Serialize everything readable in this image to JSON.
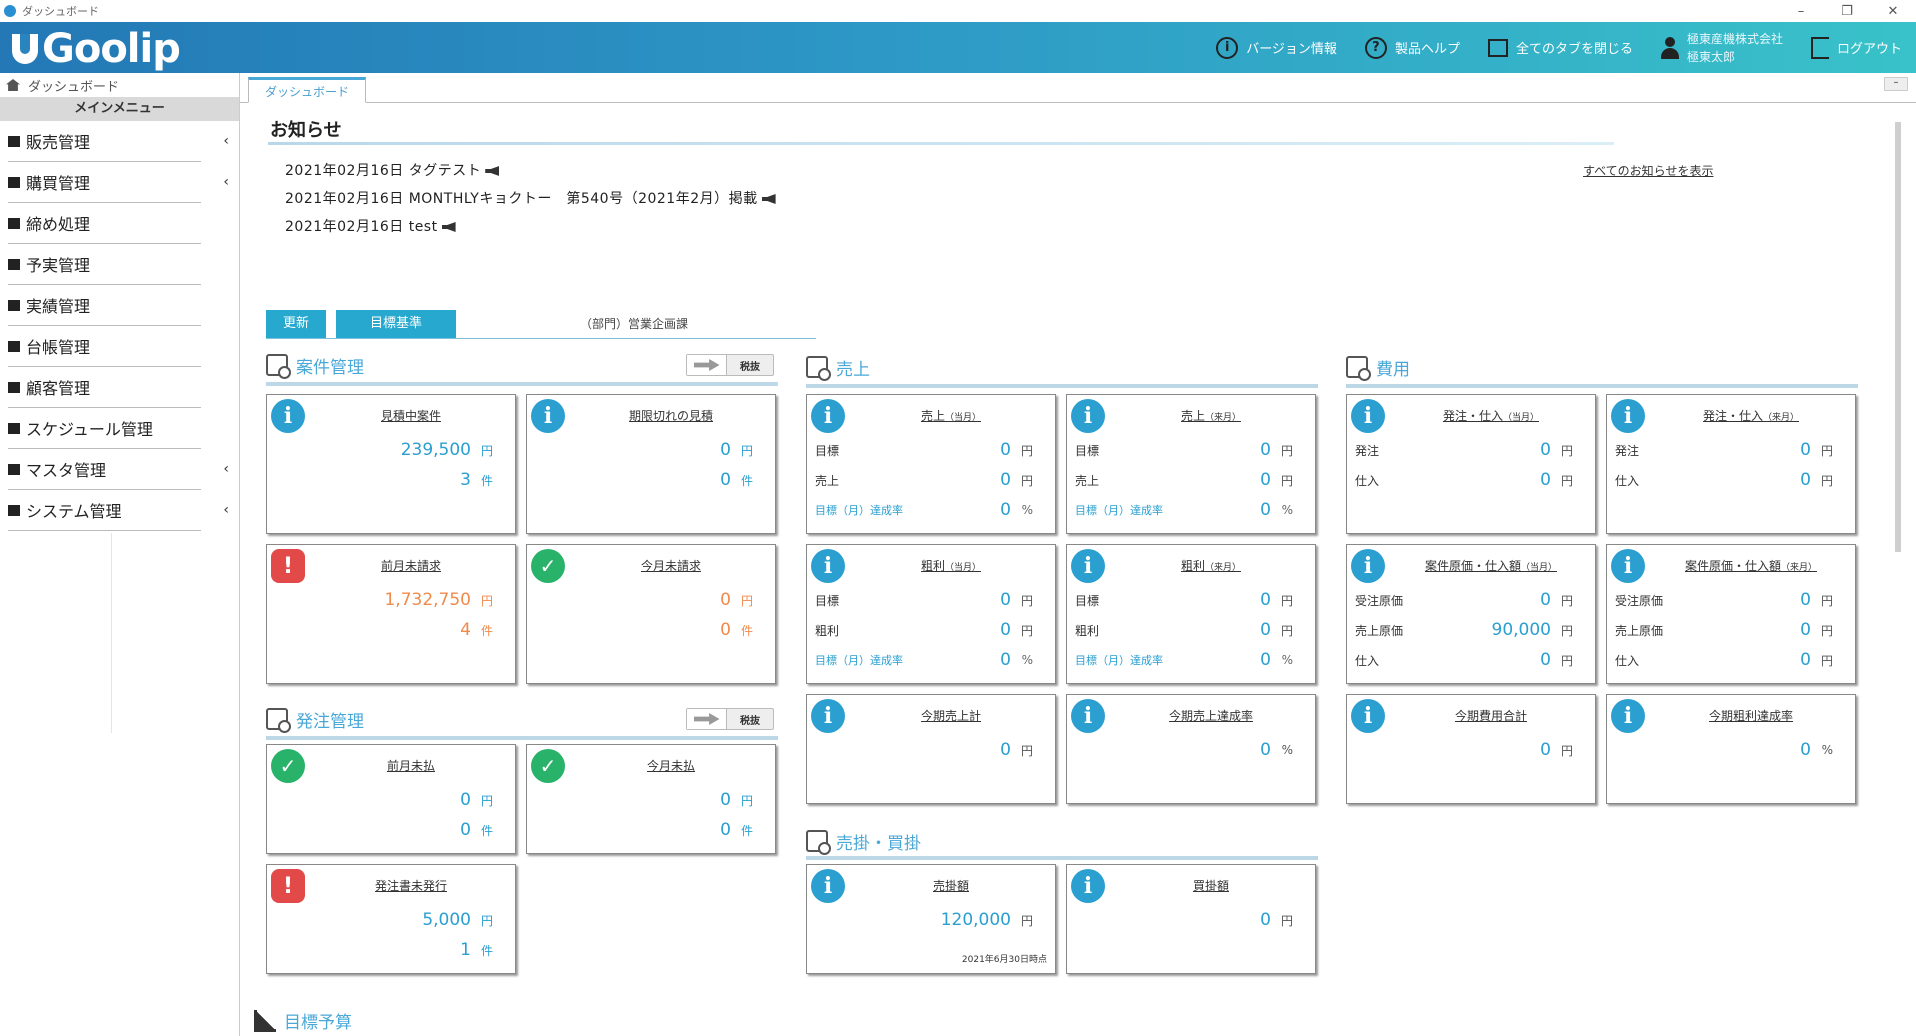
{
  "window": {
    "title": "ダッシュボード",
    "controls": [
      "–",
      "❐",
      "✕"
    ]
  },
  "header": {
    "logo": "Goolip",
    "nav": [
      {
        "icon": "info-icon",
        "label": "バージョン情報"
      },
      {
        "icon": "help-icon",
        "label": "製品ヘルプ"
      },
      {
        "icon": "tabs-close-icon",
        "label": "全てのタブを閉じる"
      }
    ],
    "user": {
      "company": "極東産機株式会社",
      "name": "極東太郎"
    },
    "logout_label": "ログアウト"
  },
  "sidebar": {
    "breadcrumb": "ダッシュボード",
    "menu_heading": "メインメニュー",
    "items": [
      {
        "label": "販売管理",
        "icon": "register-icon",
        "has_submenu": true
      },
      {
        "label": "購買管理",
        "icon": "cart-icon",
        "has_submenu": true
      },
      {
        "label": "締め処理",
        "icon": "check-box-icon",
        "has_submenu": false
      },
      {
        "label": "予実管理",
        "icon": "line-chart-icon",
        "has_submenu": false
      },
      {
        "label": "実績管理",
        "icon": "bookmark-icon",
        "has_submenu": false
      },
      {
        "label": "台帳管理",
        "icon": "ledger-icon",
        "has_submenu": false
      },
      {
        "label": "顧客管理",
        "icon": "users-icon",
        "has_submenu": false
      },
      {
        "label": "スケジュール管理",
        "icon": "calendar-icon",
        "has_submenu": false
      },
      {
        "label": "マスタ管理",
        "icon": "database-icon",
        "has_submenu": true
      },
      {
        "label": "システム管理",
        "icon": "gear-icon",
        "has_submenu": true
      }
    ],
    "chevron": "‹"
  },
  "tabs": [
    {
      "label": "ダッシュボード",
      "active": true
    }
  ],
  "tab_minimize": "–",
  "news": {
    "title": "お知らせ",
    "items": [
      "2021年02月16日 タグテスト",
      "2021年02月16日 MONTHLYキョクトー　第540号（2021年2月）掲載",
      "2021年02月16日 test"
    ],
    "show_all": "すべてのお知らせを表示"
  },
  "filters": {
    "update_label": "更新",
    "target_label": "目標基準",
    "department": "（部門）営業企画課"
  },
  "tax_label": "税抜",
  "sections": {
    "anken": "案件管理",
    "hacchu": "発注管理",
    "uriage": "売上",
    "hiyou": "費用",
    "urikake": "売掛・買掛",
    "budget": "目標予算"
  },
  "cards": {
    "mitsumori": {
      "title": "見積中案件",
      "amount": "239,500",
      "count": "3"
    },
    "kigen": {
      "title": "期限切れの見積",
      "amount": "0",
      "count": "0"
    },
    "zengetsu_seikyu": {
      "title": "前月未請求",
      "amount": "1,732,750",
      "count": "4"
    },
    "kongetsu_seikyu": {
      "title": "今月未請求",
      "amount": "0",
      "count": "0"
    },
    "zengetsu_shiharai": {
      "title": "前月未払",
      "amount": "0",
      "count": "0"
    },
    "kongetsu_shiharai": {
      "title": "今月未払",
      "amount": "0",
      "count": "0"
    },
    "hacchusho": {
      "title": "発注書未発行",
      "amount": "5,000",
      "count": "1"
    },
    "uriage_cur": {
      "title": "売上",
      "period": "（当月）",
      "target": "0",
      "sales": "0",
      "rate": "0"
    },
    "uriage_next": {
      "title": "売上",
      "period": "（来月）",
      "target": "0",
      "sales": "0",
      "rate": "0"
    },
    "arari_cur": {
      "title": "粗利",
      "period": "（当月）",
      "target": "0",
      "profit": "0",
      "rate": "0"
    },
    "arari_next": {
      "title": "粗利",
      "period": "（来月）",
      "target": "0",
      "profit": "0",
      "rate": "0"
    },
    "kikan_uriage": {
      "title": "今期売上計",
      "amount": "0"
    },
    "kikan_tassei": {
      "title": "今期売上達成率",
      "amount": "0"
    },
    "hacchu_cur": {
      "title": "発注・仕入",
      "period": "（当月）",
      "order": "0",
      "purchase": "0"
    },
    "hacchu_next": {
      "title": "発注・仕入",
      "period": "（来月）",
      "order": "0",
      "purchase": "0"
    },
    "genka_cur": {
      "title": "案件原価・仕入額",
      "period": "（当月）",
      "order_cost": "0",
      "sales_cost": "90,000",
      "purchase": "0"
    },
    "genka_next": {
      "title": "案件原価・仕入額",
      "period": "（来月）",
      "order_cost": "0",
      "sales_cost": "0",
      "purchase": "0"
    },
    "kikan_hiyou": {
      "title": "今期費用合計",
      "amount": "0"
    },
    "kikan_arari": {
      "title": "今期粗利達成率",
      "amount": "0"
    },
    "urikake": {
      "title": "売掛額",
      "amount": "120,000",
      "as_of": "2021年6月30日時点"
    },
    "kaikake": {
      "title": "買掛額",
      "amount": "0"
    }
  },
  "labels": {
    "yen": "円",
    "ken": "件",
    "pct": "%",
    "target": "目標",
    "sales": "売上",
    "profit": "粗利",
    "rate": "目標（月）達成率",
    "order": "発注",
    "purchase": "仕入",
    "order_cost": "受注原価",
    "sales_cost": "売上原価"
  }
}
